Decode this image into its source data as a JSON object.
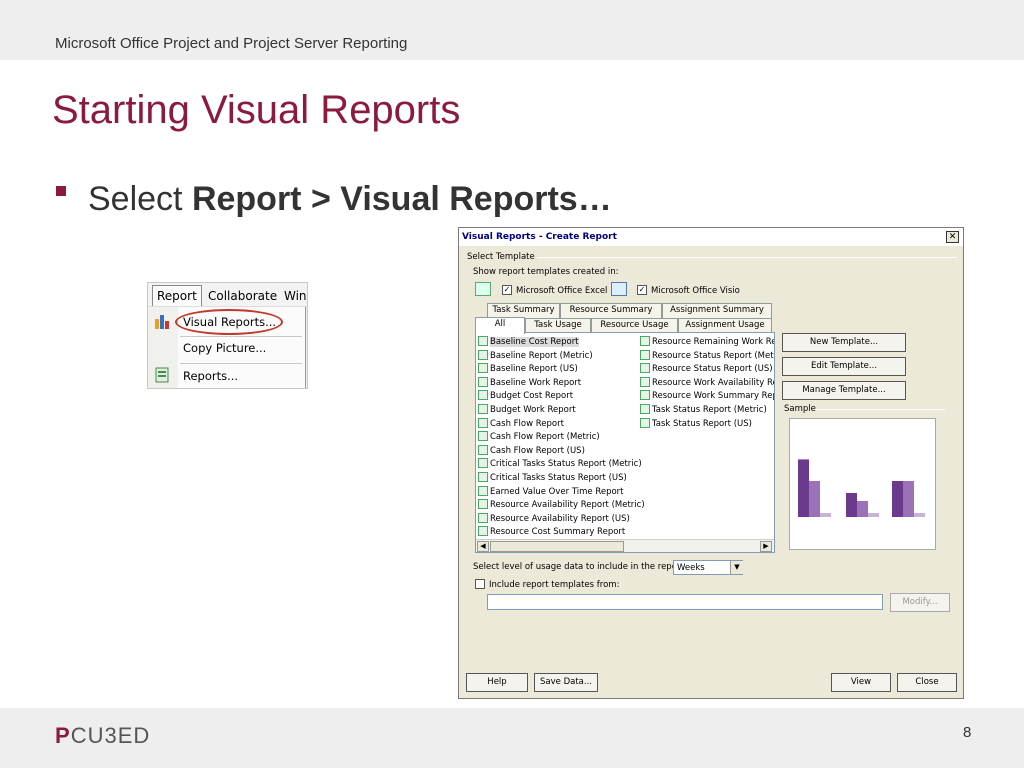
{
  "slide": {
    "subtitle": "Microsoft Office Project and Project Server Reporting",
    "title": "Starting Visual Reports",
    "bullet_prefix": "Select ",
    "bullet_bold": "Report  > Visual Reports…",
    "logo_p": "P",
    "logo_rest": "CU3ED",
    "page_number": "8",
    "accent_color": "#8b1a3c"
  },
  "menu": {
    "bar_items": [
      "Report",
      "Collaborate",
      "Wind"
    ],
    "items": [
      "Visual Reports...",
      "Copy Picture...",
      "Reports..."
    ],
    "highlight_color": "#c0392b"
  },
  "dialog": {
    "title": "Visual Reports - Create Report",
    "close_glyph": "✕",
    "select_template": "Select Template",
    "show_templates": "Show report templates created in:",
    "excel_label": "Microsoft Office Excel",
    "visio_label": "Microsoft Office Visio",
    "check_glyph": "✓",
    "tabs_top": [
      "Task Summary",
      "Resource Summary",
      "Assignment Summary"
    ],
    "tabs_bottom": [
      "All",
      "Task Usage",
      "Resource Usage",
      "Assignment Usage"
    ],
    "list_left": [
      "Baseline Cost Report",
      "Baseline Report (Metric)",
      "Baseline Report (US)",
      "Baseline Work Report",
      "Budget Cost Report",
      "Budget Work Report",
      "Cash Flow Report",
      "Cash Flow Report (Metric)",
      "Cash Flow Report (US)",
      "Critical Tasks Status Report (Metric)",
      "Critical Tasks Status Report (US)",
      "Earned Value Over Time Report",
      "Resource Availability Report (Metric)",
      "Resource Availability Report (US)",
      "Resource Cost Summary Report"
    ],
    "list_right": [
      "Resource Remaining Work Rep",
      "Resource Status Report (Metri",
      "Resource Status Report (US)",
      "Resource Work Availability Rep",
      "Resource Work Summary Repo",
      "Task Status Report (Metric)",
      "Task Status Report (US)"
    ],
    "scroll_left": "◀",
    "scroll_right": "▶",
    "new_template": "New Template...",
    "edit_template": "Edit Template...",
    "manage_template": "Manage Template...",
    "sample": "Sample",
    "usage_level_label": "Select level of usage data to include in the report:",
    "usage_level_value": "Weeks",
    "combo_arrow": "▼",
    "include_templates": "Include report templates from:",
    "modify": "Modify...",
    "help": "Help",
    "save_data": "Save Data...",
    "view": "View",
    "close": "Close",
    "sample_chart": {
      "groups": [
        {
          "values": [
            0.72,
            0.45
          ]
        },
        {
          "values": [
            0.3,
            0.2
          ]
        },
        {
          "values": [
            0.45,
            0.45
          ]
        }
      ],
      "colors": [
        "#6b3a8c",
        "#9b71b8",
        "#c9b3da"
      ]
    }
  }
}
